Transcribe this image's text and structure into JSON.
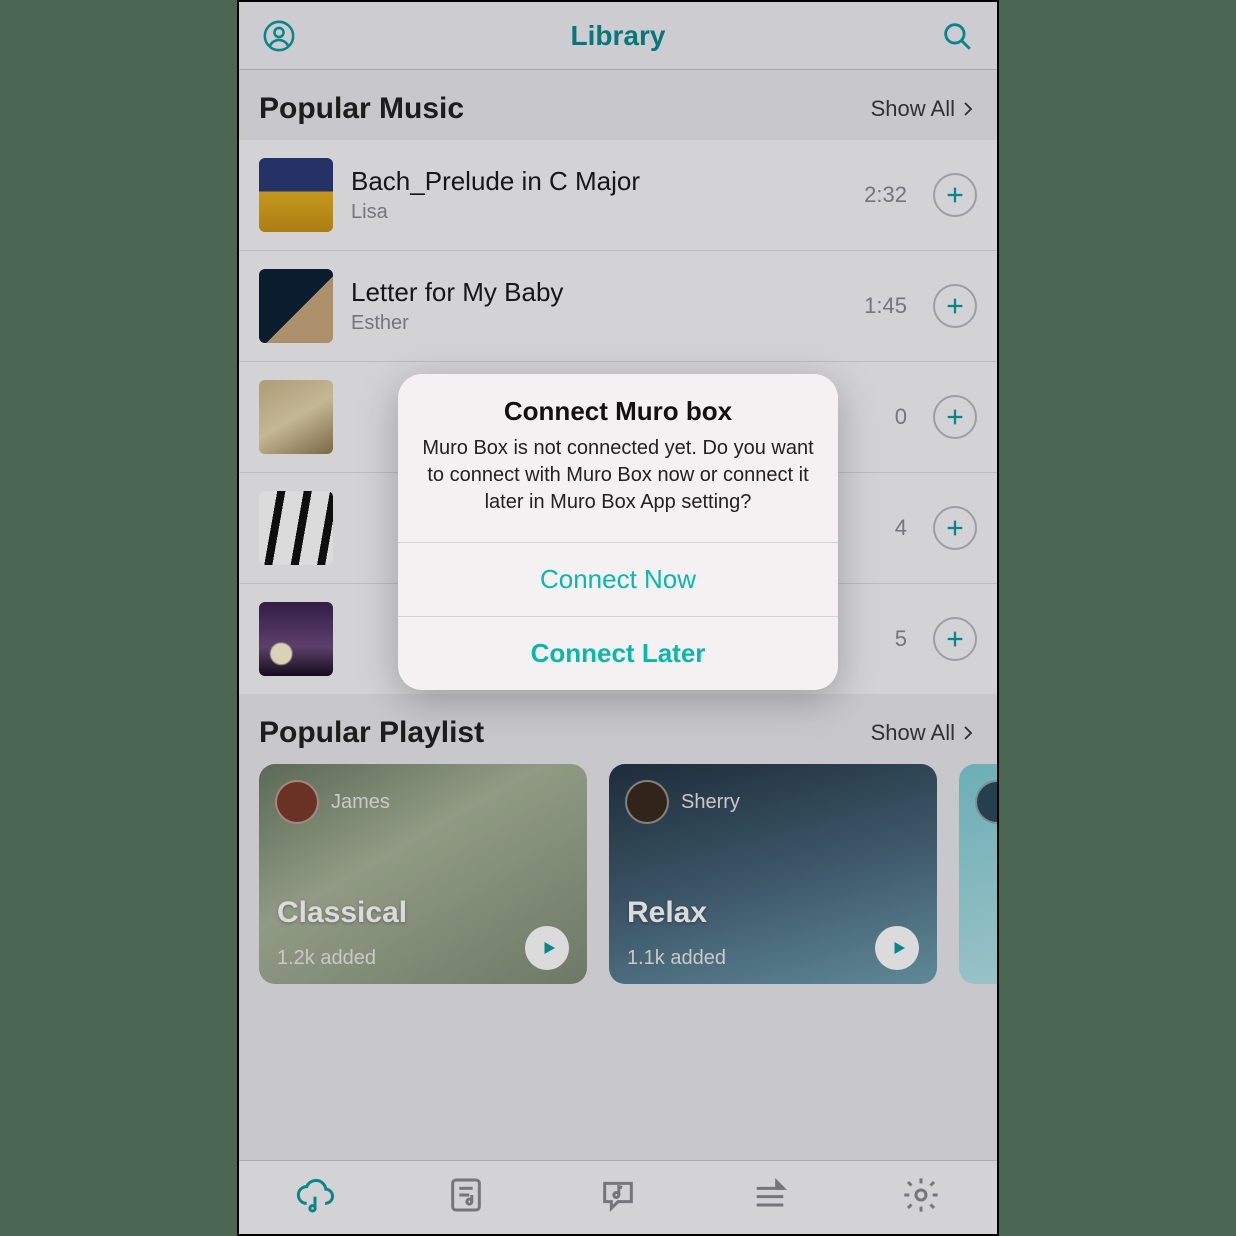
{
  "header": {
    "title": "Library"
  },
  "sections": {
    "popular_music": {
      "title": "Popular Music",
      "show_all": "Show All"
    },
    "popular_playlist": {
      "title": "Popular Playlist",
      "show_all": "Show All"
    }
  },
  "tracks": [
    {
      "title": "Bach_Prelude in C Major",
      "artist": "Lisa",
      "time": "2:32"
    },
    {
      "title": "Letter for My Baby",
      "artist": "Esther",
      "time": "1:45"
    },
    {
      "title": "",
      "artist": "",
      "time": "0"
    },
    {
      "title": "",
      "artist": "",
      "time": "4"
    },
    {
      "title": "",
      "artist": "",
      "time": "5"
    }
  ],
  "playlists": [
    {
      "creator": "James",
      "name": "Classical",
      "added": "1.2k added"
    },
    {
      "creator": "Sherry",
      "name": "Relax",
      "added": "1.1k added"
    },
    {
      "creator": "",
      "name": "",
      "added": ""
    }
  ],
  "dialog": {
    "title": "Connect Muro box",
    "message": "Muro Box is not connected yet. Do you want to connect with Muro Box now or connect it later in Muro Box App setting?",
    "primary": "Connect Now",
    "secondary": "Connect Later"
  },
  "colors": {
    "accent": "#0b8a8f",
    "link_teal": "#0bb7ab"
  }
}
